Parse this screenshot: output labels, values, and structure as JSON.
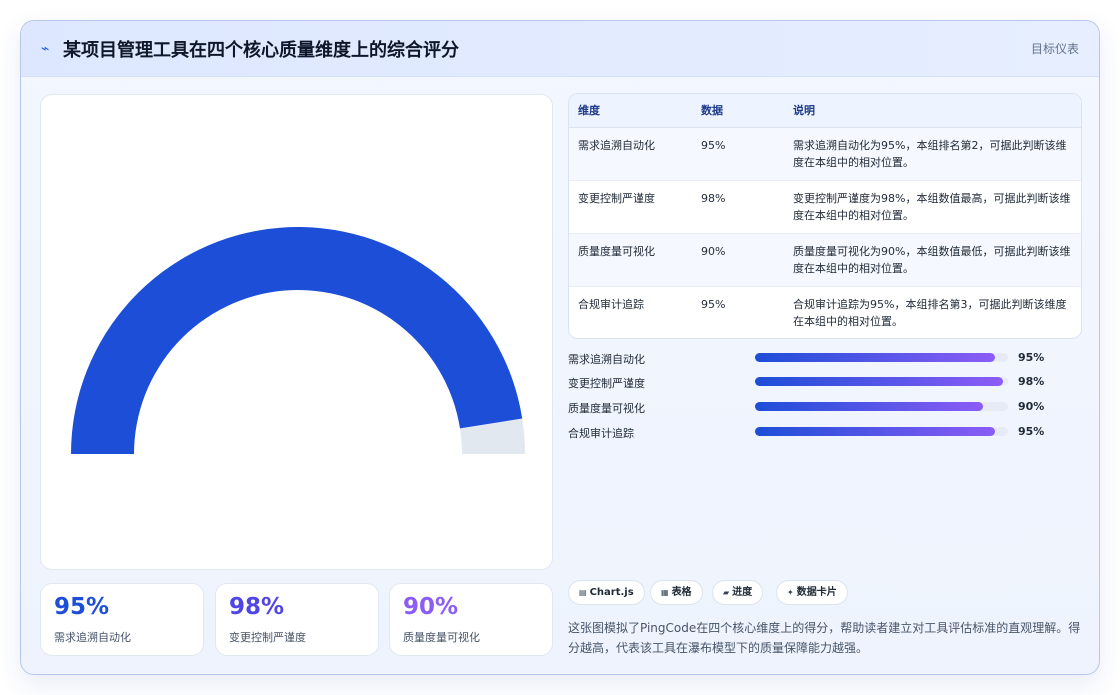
{
  "header": {
    "title": "某项目管理工具在四个核心质量维度上的综合评分",
    "tag": "目标仪表"
  },
  "colors": {
    "gauge": "#1d4ed8",
    "gauge_track": "#e2e8f0",
    "kpi": [
      "#1d4ed8",
      "#4f46e5",
      "#8b5cf6"
    ]
  },
  "chart_data": {
    "type": "gauge",
    "title": "",
    "value": 95,
    "max": 100,
    "unit": "%",
    "categories": [
      "需求追溯自动化",
      "变更控制严谨度",
      "质量度量可视化",
      "合规审计追踪"
    ],
    "values": [
      95,
      98,
      90,
      95
    ]
  },
  "table": {
    "headers": [
      "维度",
      "数据",
      "说明"
    ],
    "rows": [
      [
        "需求追溯自动化",
        "95%",
        "需求追溯自动化为95%，本组排名第2，可据此判断该维度在本组中的相对位置。"
      ],
      [
        "变更控制严谨度",
        "98%",
        "变更控制严谨度为98%，本组数值最高，可据此判断该维度在本组中的相对位置。"
      ],
      [
        "质量度量可视化",
        "90%",
        "质量度量可视化为90%，本组数值最低，可据此判断该维度在本组中的相对位置。"
      ],
      [
        "合规审计追踪",
        "95%",
        "合规审计追踪为95%，本组排名第3，可据此判断该维度在本组中的相对位置。"
      ]
    ]
  },
  "bars": [
    {
      "label": "需求追溯自动化",
      "value": 95,
      "text": "95%"
    },
    {
      "label": "变更控制严谨度",
      "value": 98,
      "text": "98%"
    },
    {
      "label": "质量度量可视化",
      "value": 90,
      "text": "90%"
    },
    {
      "label": "合规审计追踪",
      "value": 95,
      "text": "95%"
    }
  ],
  "kpis": [
    {
      "value": "95%",
      "label": "需求追溯自动化"
    },
    {
      "value": "98%",
      "label": "变更控制严谨度"
    },
    {
      "value": "90%",
      "label": "质量度量可视化"
    }
  ],
  "chips": [
    {
      "icon": "chart-icon",
      "glyph": "▤",
      "label": "Chart.js"
    },
    {
      "icon": "table-icon",
      "glyph": "▦",
      "label": "表格"
    },
    {
      "icon": "progress-icon",
      "glyph": "▰",
      "label": "进度"
    },
    {
      "icon": "sparkle-icon",
      "glyph": "✦",
      "label": "数据卡片"
    }
  ],
  "description": "这张图模拟了PingCode在四个核心维度上的得分，帮助读者建立对工具评估标准的直观理解。得分越高，代表该工具在瀑布模型下的质量保障能力越强。"
}
